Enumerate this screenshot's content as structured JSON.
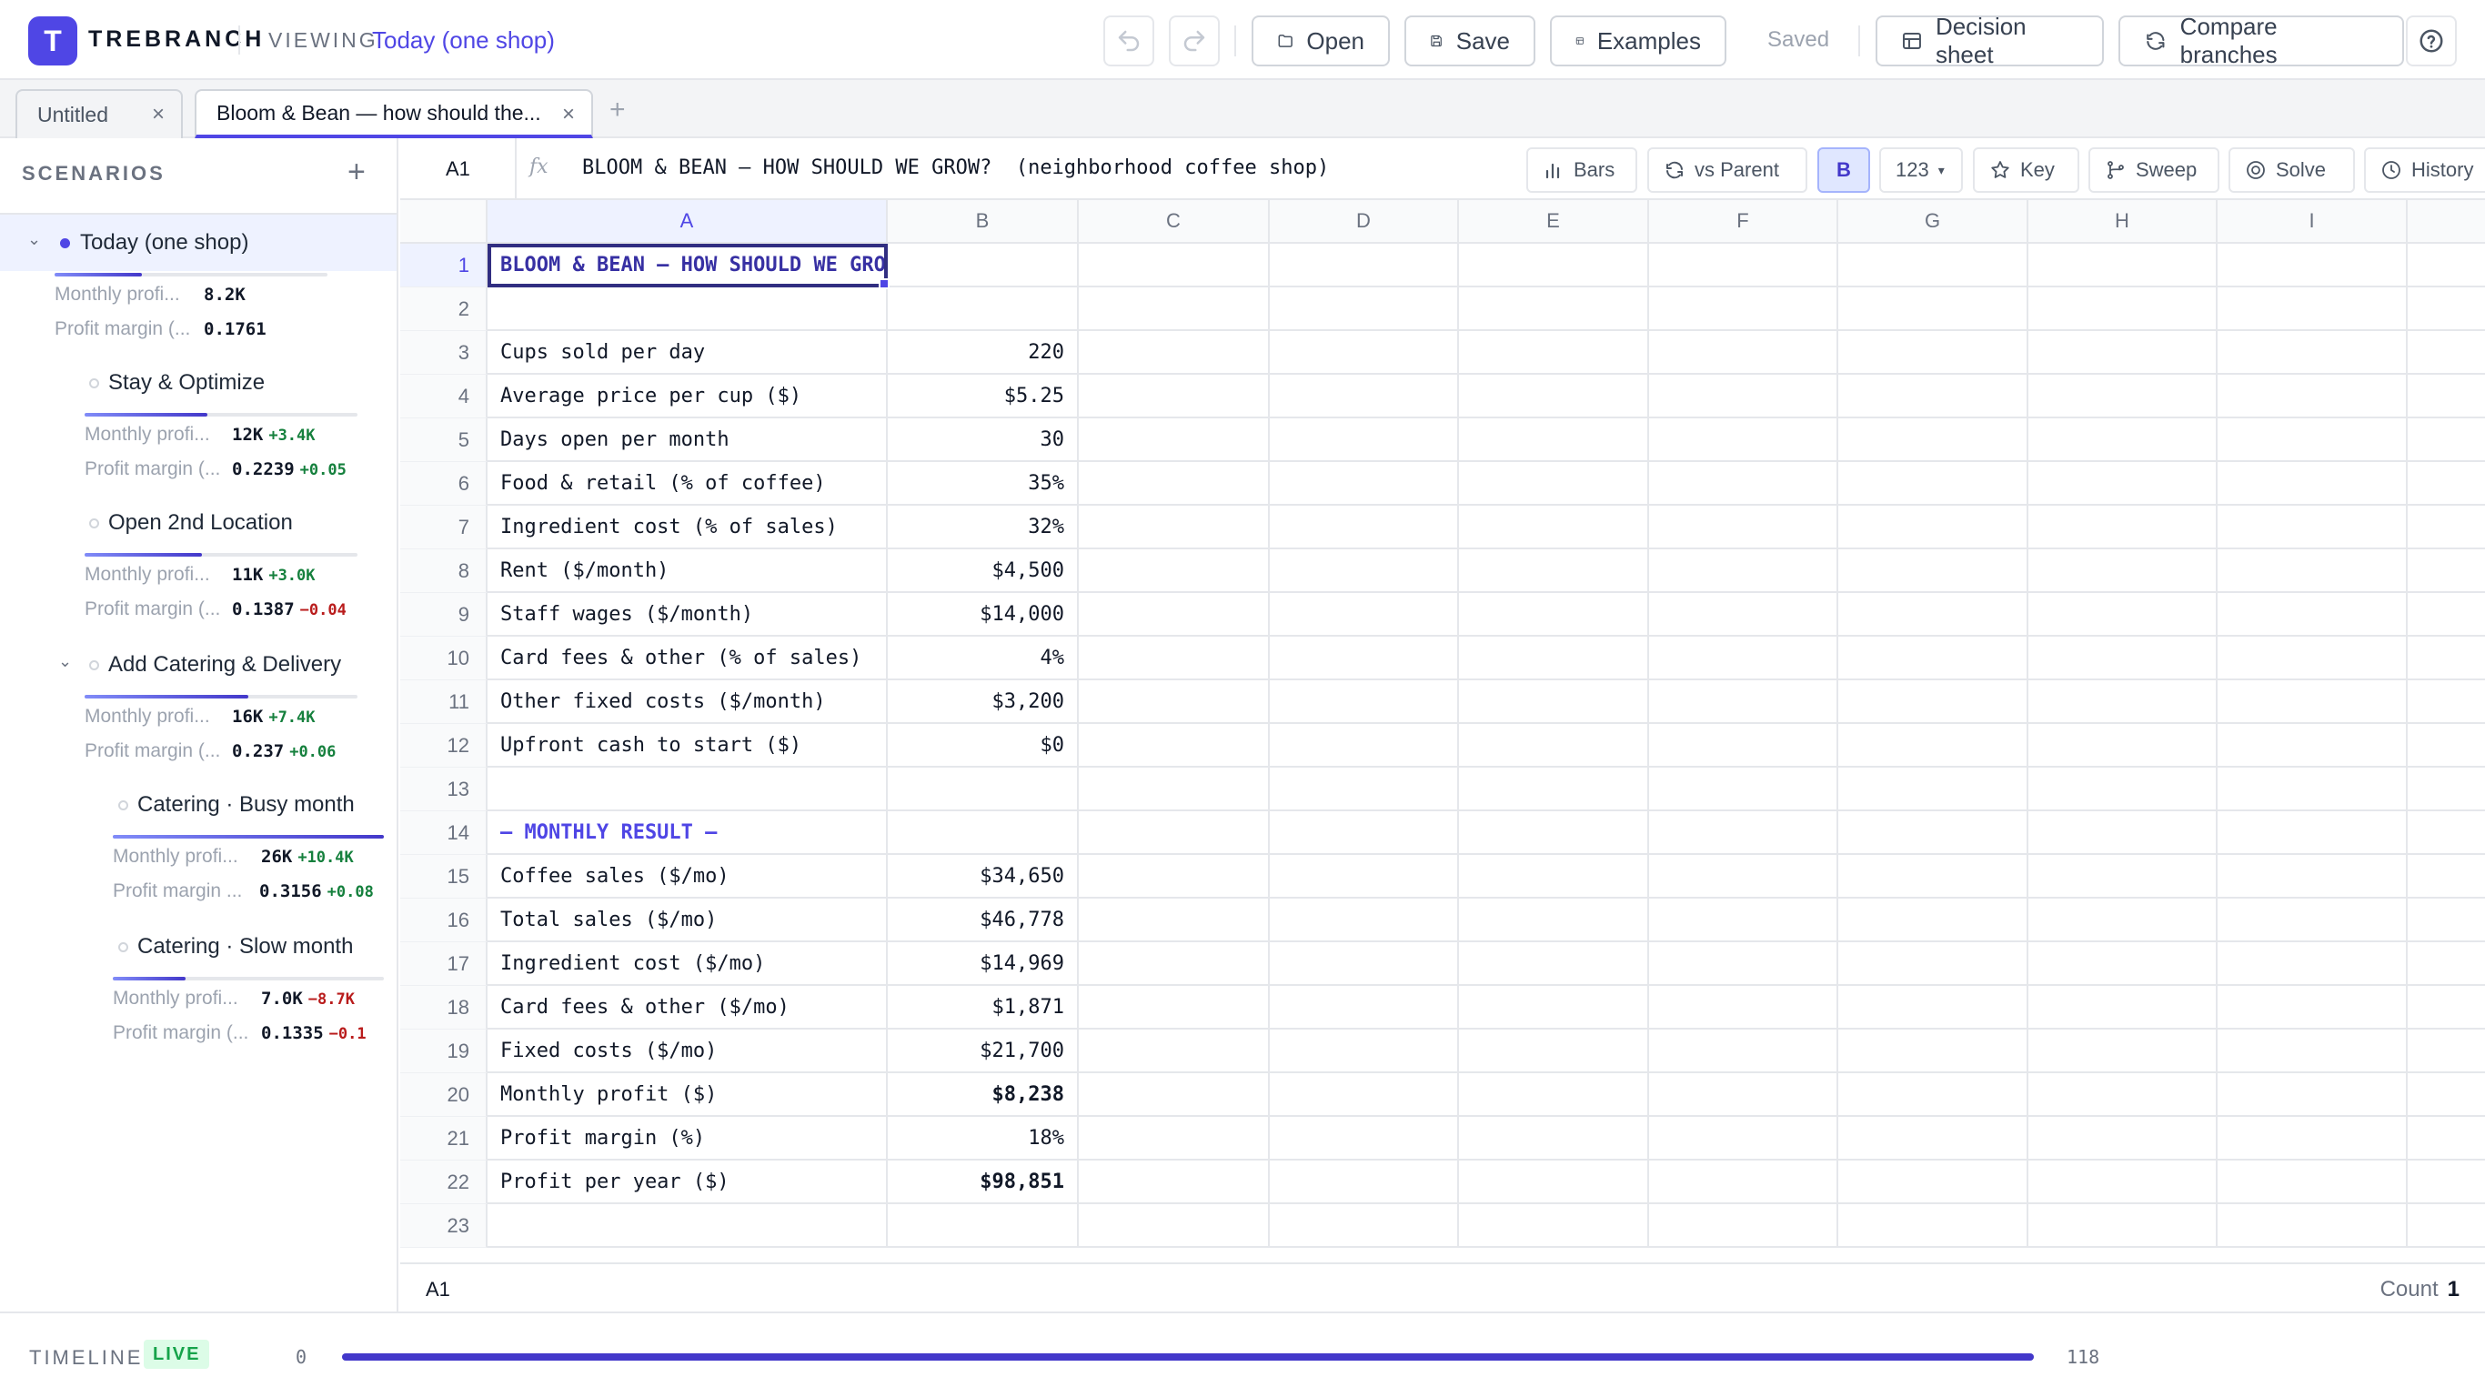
{
  "app": {
    "logo_letter": "T",
    "brand": "TREBRANCH",
    "viewing_label": "VIEWING",
    "viewing_value": "Today (one shop)"
  },
  "toolbar": {
    "open": "Open",
    "save": "Save",
    "examples": "Examples",
    "status": "Saved",
    "decision_sheet": "Decision sheet",
    "compare_branches": "Compare branches"
  },
  "tabs": [
    {
      "label": "Untitled",
      "active": false
    },
    {
      "label": "Bloom & Bean — how should the...",
      "active": true
    }
  ],
  "sidebar": {
    "title": "SCENARIOS",
    "scenarios": [
      {
        "name": "Today (one shop)",
        "active": true,
        "expanded": true,
        "profit_label": "Monthly profi...",
        "profit": "8.2K",
        "profit_delta": "",
        "margin_label": "Profit margin (...",
        "margin": "0.1761",
        "margin_delta": "",
        "bar_fraction": 0.32
      },
      {
        "name": "Stay & Optimize",
        "profit_label": "Monthly profi...",
        "profit": "12K",
        "profit_delta": "+3.4K",
        "margin_label": "Profit margin (...",
        "margin": "0.2239",
        "margin_delta": "+0.05",
        "bar_fraction": 0.45
      },
      {
        "name": "Open 2nd Location",
        "profit_label": "Monthly profi...",
        "profit": "11K",
        "profit_delta": "+3.0K",
        "margin_label": "Profit margin (...",
        "margin": "0.1387",
        "margin_delta": "−0.04",
        "bar_fraction": 0.43
      },
      {
        "name": "Add Catering & Delivery",
        "expanded": true,
        "profit_label": "Monthly profi...",
        "profit": "16K",
        "profit_delta": "+7.4K",
        "margin_label": "Profit margin (...",
        "margin": "0.237",
        "margin_delta": "+0.06",
        "bar_fraction": 0.6
      },
      {
        "name": "Catering · Busy month",
        "profit_label": "Monthly profi...",
        "profit": "26K",
        "profit_delta": "+10.4K",
        "margin_label": "Profit margin ...",
        "margin": "0.3156",
        "margin_delta": "+0.08",
        "bar_fraction": 1.0
      },
      {
        "name": "Catering · Slow month",
        "profit_label": "Monthly profi...",
        "profit": "7.0K",
        "profit_delta": "−8.7K",
        "margin_label": "Profit margin (...",
        "margin": "0.1335",
        "margin_delta": "−0.1",
        "bar_fraction": 0.27
      }
    ]
  },
  "formula_bar": {
    "cell_ref": "A1",
    "fx": "fx",
    "formula": "BLOOM & BEAN — HOW SHOULD WE GROW?  (neighborhood coffee shop)",
    "buttons": {
      "bars": "Bars",
      "vs_parent": "vs Parent",
      "b": "B",
      "format": "123",
      "key": "Key",
      "sweep": "Sweep",
      "solve": "Solve",
      "history": "History"
    }
  },
  "grid": {
    "columns": [
      "A",
      "B",
      "C",
      "D",
      "E",
      "F",
      "G",
      "H",
      "I"
    ],
    "rows": [
      {
        "n": "1",
        "a": "BLOOM & BEAN — HOW SHOULD WE GROW?",
        "b": ""
      },
      {
        "n": "2",
        "a": "",
        "b": ""
      },
      {
        "n": "3",
        "a": "Cups sold per day",
        "b": "220"
      },
      {
        "n": "4",
        "a": "Average price per cup ($)",
        "b": "$5.25"
      },
      {
        "n": "5",
        "a": "Days open per month",
        "b": "30"
      },
      {
        "n": "6",
        "a": "Food & retail (% of coffee)",
        "b": "35%"
      },
      {
        "n": "7",
        "a": "Ingredient cost (% of sales)",
        "b": "32%"
      },
      {
        "n": "8",
        "a": "Rent ($/month)",
        "b": "$4,500"
      },
      {
        "n": "9",
        "a": "Staff wages ($/month)",
        "b": "$14,000"
      },
      {
        "n": "10",
        "a": "Card fees & other (% of sales)",
        "b": "4%"
      },
      {
        "n": "11",
        "a": "Other fixed costs ($/month)",
        "b": "$3,200"
      },
      {
        "n": "12",
        "a": "Upfront cash to start ($)",
        "b": "$0"
      },
      {
        "n": "13",
        "a": "",
        "b": ""
      },
      {
        "n": "14",
        "a": "— MONTHLY RESULT —",
        "b": ""
      },
      {
        "n": "15",
        "a": "Coffee sales ($/mo)",
        "b": "$34,650"
      },
      {
        "n": "16",
        "a": "Total sales ($/mo)",
        "b": "$46,778"
      },
      {
        "n": "17",
        "a": "Ingredient cost ($/mo)",
        "b": "$14,969"
      },
      {
        "n": "18",
        "a": "Card fees & other ($/mo)",
        "b": "$1,871"
      },
      {
        "n": "19",
        "a": "Fixed costs ($/mo)",
        "b": "$21,700"
      },
      {
        "n": "20",
        "a": "Monthly profit ($)",
        "b": "$8,238"
      },
      {
        "n": "21",
        "a": "Profit margin (%)",
        "b": "18%"
      },
      {
        "n": "22",
        "a": "Profit per year ($)",
        "b": "$98,851"
      },
      {
        "n": "23",
        "a": "",
        "b": ""
      }
    ]
  },
  "status_bar": {
    "cell_ref": "A1",
    "count_label": "Count",
    "count_value": "1"
  },
  "timeline": {
    "label": "TIMELINE",
    "live": "LIVE",
    "min": "0",
    "max": "118",
    "position_fraction": 1.0
  }
}
